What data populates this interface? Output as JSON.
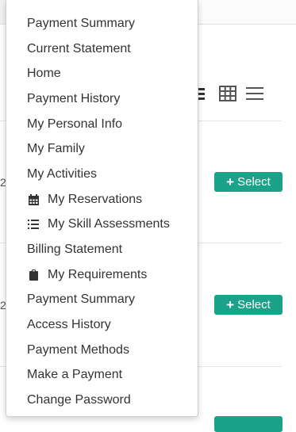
{
  "menu": {
    "items": [
      {
        "label": "Payment Summary"
      },
      {
        "label": "Current Statement"
      },
      {
        "label": "Home"
      },
      {
        "label": "Payment History"
      },
      {
        "label": "My Personal Info"
      },
      {
        "label": "My Family"
      },
      {
        "label": "My Activities"
      },
      {
        "label": "My Reservations",
        "icon": "calendar-icon"
      },
      {
        "label": "My Skill Assessments",
        "icon": "list-icon"
      },
      {
        "label": "Billing Statement"
      },
      {
        "label": "My Requirements",
        "icon": "clipboard-icon"
      },
      {
        "label": "Payment Summary"
      },
      {
        "label": "Access History"
      },
      {
        "label": "Payment Methods"
      },
      {
        "label": "Make a Payment"
      },
      {
        "label": "Change Password"
      }
    ]
  },
  "background": {
    "rows": [
      {
        "fragment": "2:",
        "button_label": "Select"
      },
      {
        "fragment": "2:",
        "button_label": "Select"
      }
    ],
    "accent_color": "#1aa389"
  }
}
